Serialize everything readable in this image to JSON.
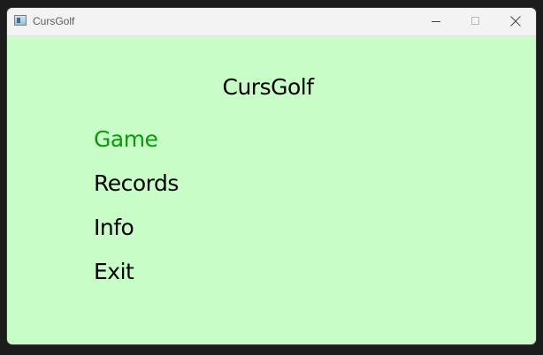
{
  "window": {
    "title": "CursGolf"
  },
  "screen": {
    "title": "CursGolf",
    "menu": [
      {
        "label": "Game",
        "selected": true
      },
      {
        "label": "Records",
        "selected": false
      },
      {
        "label": "Info",
        "selected": false
      },
      {
        "label": "Exit",
        "selected": false
      }
    ]
  },
  "colors": {
    "background": "#c9fdc8",
    "selected": "#0b9a0b",
    "text": "#000000"
  }
}
